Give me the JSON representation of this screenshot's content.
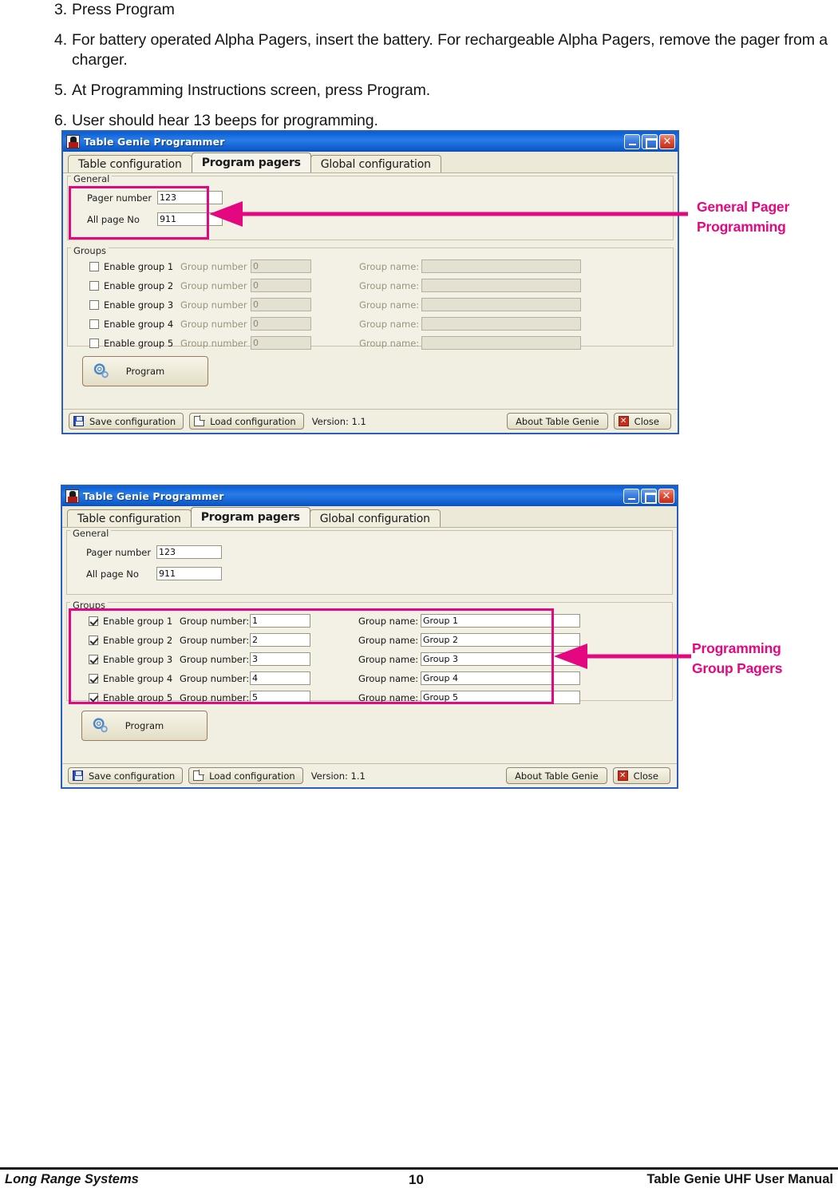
{
  "instructions": [
    {
      "num": "3.",
      "text": "Press Program"
    },
    {
      "num": "4.",
      "text": "For battery operated Alpha Pagers, insert the battery.  For rechargeable Alpha Pagers, remove the pager from a charger."
    },
    {
      "num": "5.",
      "text": "At Programming Instructions screen, press Program."
    },
    {
      "num": "6.",
      "text": "User should hear 13 beeps for programming."
    }
  ],
  "window": {
    "title": "Table Genie Programmer",
    "tabs": [
      {
        "label": "Table configuration",
        "active": false
      },
      {
        "label": "Program pagers",
        "active": true
      },
      {
        "label": "Global configuration",
        "active": false
      }
    ],
    "general": {
      "legend": "General",
      "pager_number_label": "Pager number",
      "all_page_no_label": "All page No"
    },
    "groups": {
      "legend": "Groups"
    },
    "program_button": "Program",
    "statusbar": {
      "save": "Save configuration",
      "load": "Load configuration",
      "version": "Version: 1.1",
      "about": "About Table Genie",
      "close": "Close"
    },
    "min_label": "_",
    "max_label": "□",
    "close_label": "✕"
  },
  "screenshot_one": {
    "general": {
      "pager_number": "123",
      "all_page_no": "911"
    },
    "groups": [
      {
        "enable_label": "Enable group 1",
        "checked": false,
        "number_label": "Group number",
        "number": "0",
        "name_label": "Group name:",
        "name": ""
      },
      {
        "enable_label": "Enable group 2",
        "checked": false,
        "number_label": "Group number",
        "number": "0",
        "name_label": "Group name:",
        "name": ""
      },
      {
        "enable_label": "Enable group 3",
        "checked": false,
        "number_label": "Group number",
        "number": "0",
        "name_label": "Group name:",
        "name": ""
      },
      {
        "enable_label": "Enable group 4",
        "checked": false,
        "number_label": "Group number",
        "number": "0",
        "name_label": "Group name:",
        "name": ""
      },
      {
        "enable_label": "Enable group 5",
        "checked": false,
        "number_label": "Group number",
        "number": "0",
        "name_label": "Group name:",
        "name": ""
      }
    ],
    "annotation": {
      "line1": "General Pager",
      "line2": "Programming"
    }
  },
  "screenshot_two": {
    "general": {
      "pager_number": "123",
      "all_page_no": "911"
    },
    "groups": [
      {
        "enable_label": "Enable group 1",
        "checked": true,
        "number_label": "Group number:",
        "number": "1",
        "name_label": "Group name:",
        "name": "Group 1"
      },
      {
        "enable_label": "Enable group 2",
        "checked": true,
        "number_label": "Group number:",
        "number": "2",
        "name_label": "Group name:",
        "name": "Group 2"
      },
      {
        "enable_label": "Enable group 3",
        "checked": true,
        "number_label": "Group number:",
        "number": "3",
        "name_label": "Group name:",
        "name": "Group 3"
      },
      {
        "enable_label": "Enable group 4",
        "checked": true,
        "number_label": "Group number:",
        "number": "4",
        "name_label": "Group name:",
        "name": "Group 4"
      },
      {
        "enable_label": "Enable group 5",
        "checked": true,
        "number_label": "Group number:",
        "number": "5",
        "name_label": "Group name:",
        "name": "Group 5"
      }
    ],
    "annotation": {
      "line1": "Programming",
      "line2": "Group Pagers"
    }
  },
  "footer": {
    "left": "Long Range Systems",
    "page": "10",
    "right": "Table Genie UHF User Manual"
  },
  "colors": {
    "annotation": "#e5077f",
    "titlebar": "#0d63d8",
    "window_face": "#ece9d8"
  }
}
